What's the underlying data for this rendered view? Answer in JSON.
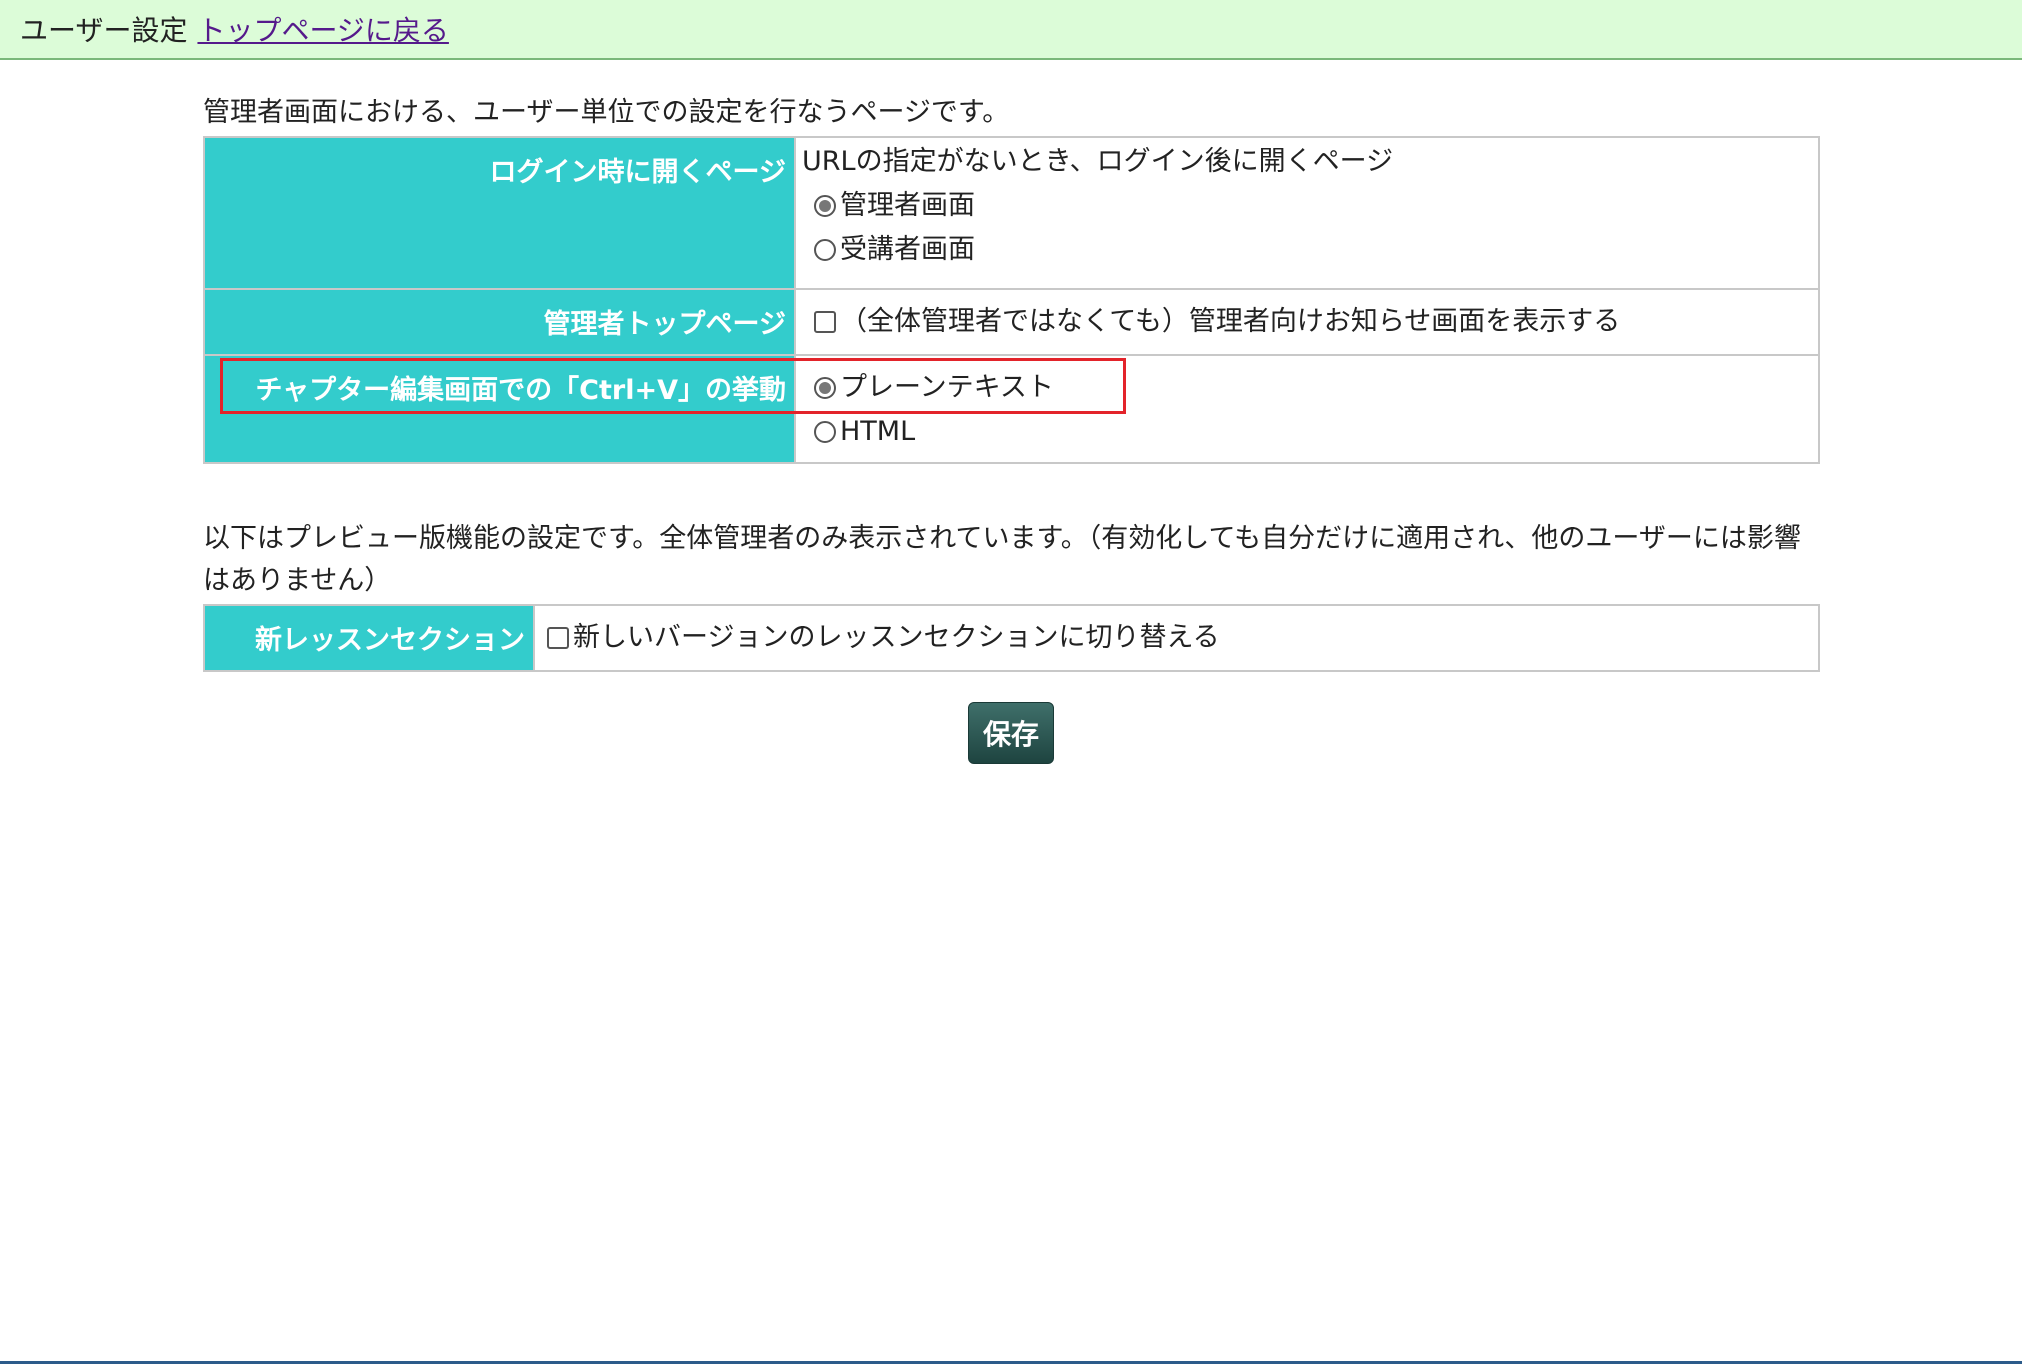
{
  "header": {
    "title": "ユーザー設定",
    "back_link": "トップページに戻る"
  },
  "intro": "管理者画面における、ユーザー単位での設定を行なうページです。",
  "settings": {
    "login_page": {
      "label": "ログイン時に開くページ",
      "description": "URLの指定がないとき、ログイン後に開くページ",
      "options": [
        "管理者画面",
        "受講者画面"
      ],
      "selected": "管理者画面"
    },
    "admin_top": {
      "label": "管理者トップページ",
      "checkbox_label": "（全体管理者ではなくても）管理者向けお知らせ画面を表示する",
      "checked": false
    },
    "paste_behavior": {
      "label": "チャプター編集画面での「Ctrl+V」の挙動",
      "options": [
        "プレーンテキスト",
        "HTML"
      ],
      "selected": "プレーンテキスト"
    }
  },
  "preview_note": "以下はプレビュー版機能の設定です。全体管理者のみ表示されています。（有効化しても自分だけに適用され、他のユーザーには影響はありません）",
  "preview_settings": {
    "new_lesson": {
      "label": "新レッスンセクション",
      "checkbox_label": "新しいバージョンのレッスンセクションに切り替える",
      "checked": false
    }
  },
  "save_label": "保存",
  "colors": {
    "header_bg": "#dcfcd8",
    "label_bg": "#33cccc",
    "highlight": "#e3232a",
    "save_bg": "#2e5a55"
  }
}
